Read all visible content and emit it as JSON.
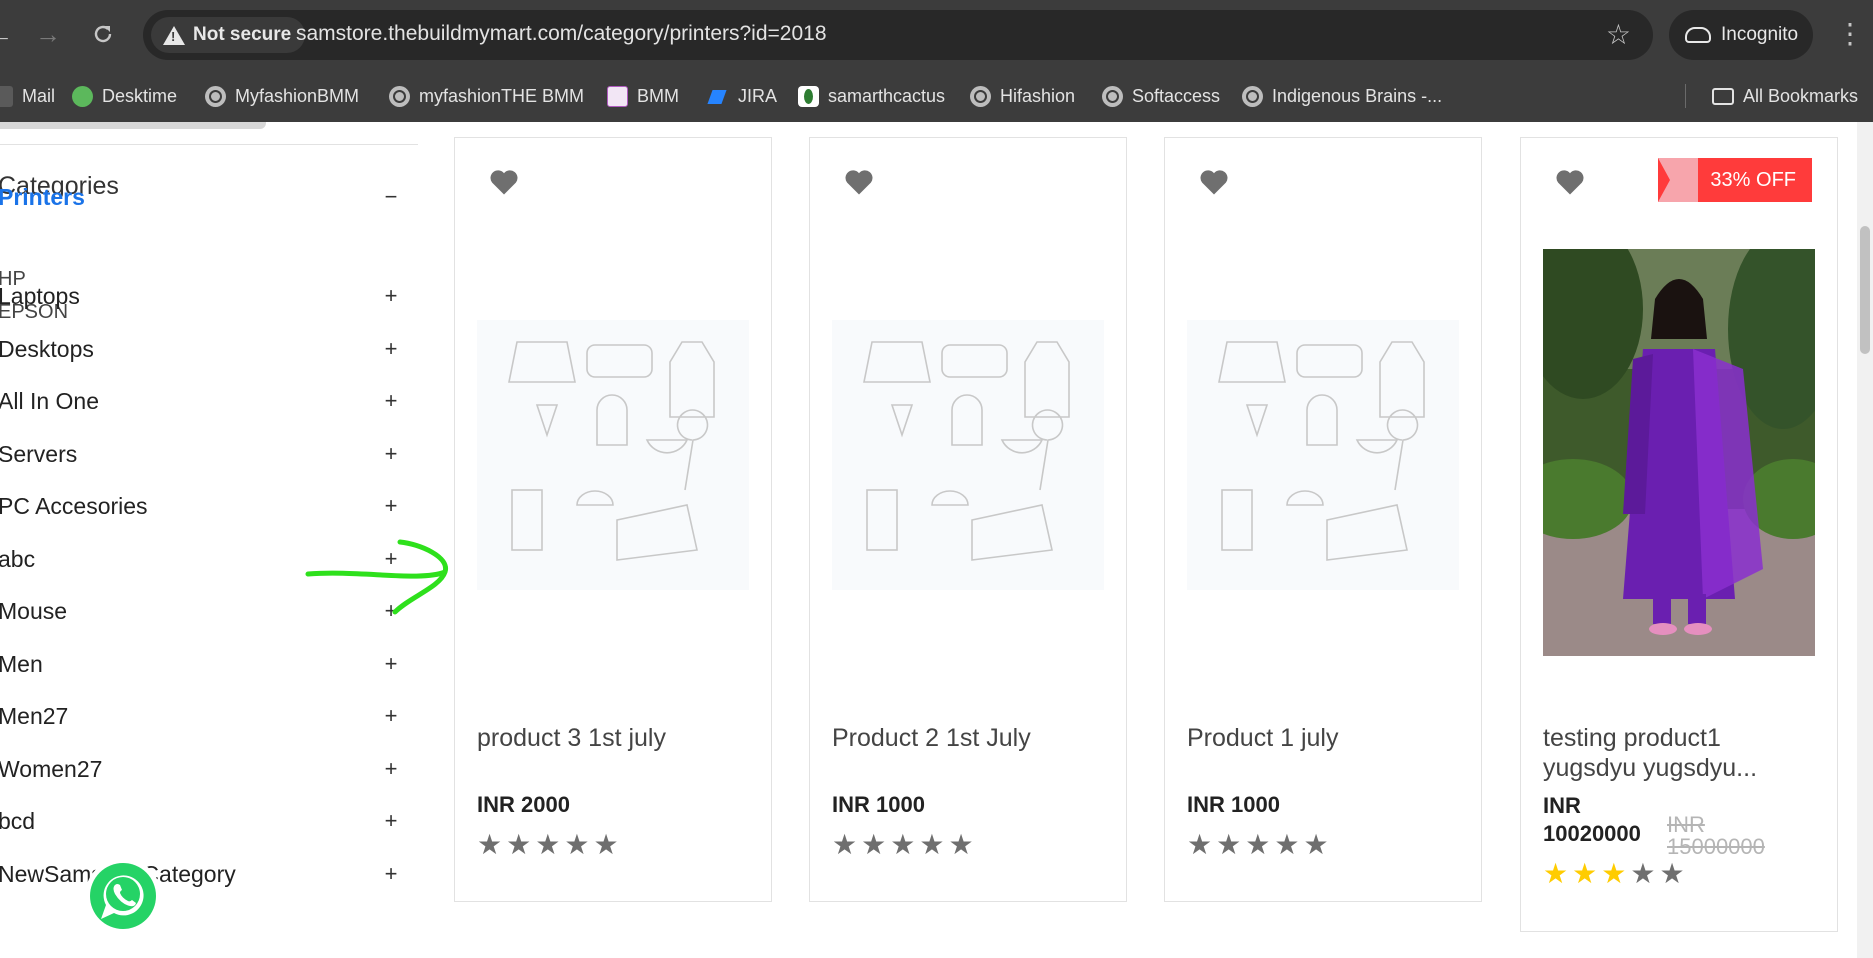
{
  "browser": {
    "security_label": "Not secure",
    "url": "samstore.thebuildmymart.com/category/printers?id=2018",
    "profile_label": "Incognito",
    "bookmarks": [
      {
        "label": "Mail",
        "icon": "mail-icon"
      },
      {
        "label": "Desktime",
        "icon": "desktime-icon"
      },
      {
        "label": "MyfashionBMM",
        "icon": "globe-icon"
      },
      {
        "label": "myfashionTHE BMM",
        "icon": "globe-icon"
      },
      {
        "label": "BMM",
        "icon": "bmm-icon"
      },
      {
        "label": "JIRA",
        "icon": "jira-icon"
      },
      {
        "label": "samarthcactus",
        "icon": "cactus-icon"
      },
      {
        "label": "Hifashion",
        "icon": "globe-icon"
      },
      {
        "label": "Softaccess",
        "icon": "globe-icon"
      },
      {
        "label": "Indigenous Brains -...",
        "icon": "globe-icon"
      }
    ],
    "all_bookmarks_label": "All Bookmarks"
  },
  "sidebar": {
    "title": "Categories",
    "active_category": {
      "label": "Printers",
      "toggle": "−"
    },
    "subcategories": [
      "HP",
      "EPSON"
    ],
    "categories": [
      {
        "label": "Laptops",
        "toggle": "+"
      },
      {
        "label": "Desktops",
        "toggle": "+"
      },
      {
        "label": "All In One",
        "toggle": "+"
      },
      {
        "label": "Servers",
        "toggle": "+"
      },
      {
        "label": "PC Accesories",
        "toggle": "+"
      },
      {
        "label": "abc",
        "toggle": "+"
      },
      {
        "label": "Mouse",
        "toggle": "+"
      },
      {
        "label": "Men",
        "toggle": "+"
      },
      {
        "label": "Men27",
        "toggle": "+"
      },
      {
        "label": "Women27",
        "toggle": "+"
      },
      {
        "label": "bcd",
        "toggle": "+"
      },
      {
        "label": "NewSamstoreCategory",
        "toggle": "+"
      }
    ]
  },
  "products": [
    {
      "name": "product 3 1st july",
      "price": "INR 2000",
      "rating": 0,
      "image": "placeholder"
    },
    {
      "name": "Product 2 1st July",
      "price": "INR 1000",
      "rating": 0,
      "image": "placeholder"
    },
    {
      "name": "Product 1 july",
      "price": "INR 1000",
      "rating": 0,
      "image": "placeholder"
    },
    {
      "name_line1": "testing product1",
      "name_line2": "yugsdyu yugsdyu...",
      "price_line1": "INR",
      "price_line2": "10020000",
      "old_price": "INR 15000000",
      "discount": "33% OFF",
      "rating": 3,
      "image": "photo"
    }
  ],
  "colors": {
    "accent": "#1a73e8",
    "discount": "#ff3b3b",
    "star_filled": "#ffcc00",
    "star_empty": "#6f6f6f",
    "annotation_arrow": "#2ee01c",
    "chrome_bg": "#3c3c3c"
  }
}
